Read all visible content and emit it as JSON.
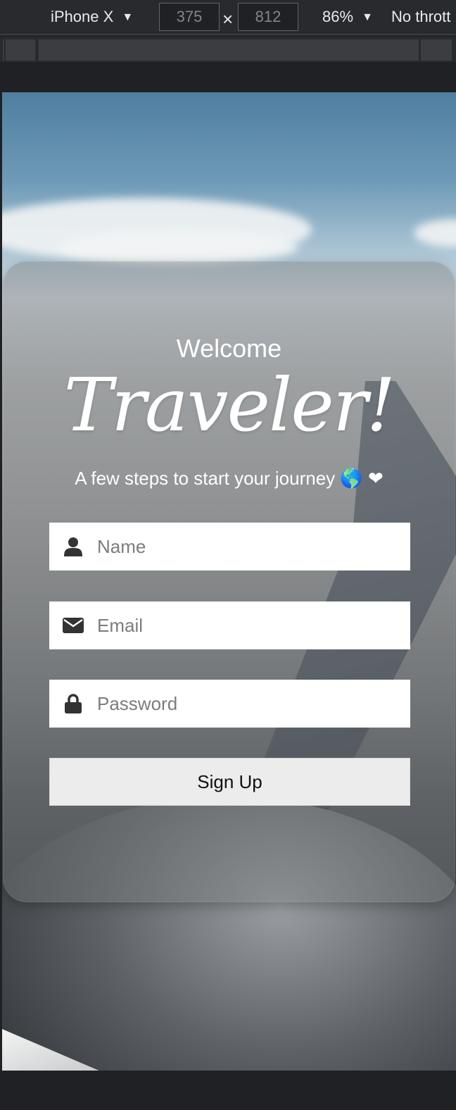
{
  "devtools": {
    "device": "iPhone X",
    "width": "375",
    "height": "812",
    "separator": "×",
    "zoom": "86%",
    "throttle": "No thrott",
    "caret": "▼"
  },
  "page": {
    "welcome": "Welcome",
    "title": "Traveler!",
    "subtitle": "A few steps to start your journey 🌎 ❤",
    "fields": [
      {
        "placeholder": "Name",
        "icon": "user-icon"
      },
      {
        "placeholder": "Email",
        "icon": "envelope-icon"
      },
      {
        "placeholder": "Password",
        "icon": "lock-icon"
      }
    ],
    "submit_label": "Sign Up"
  },
  "colors": {
    "card_overlay": "#787a7c",
    "input_bg": "#ffffff",
    "button_bg": "#ececec",
    "icon": "#333333"
  }
}
